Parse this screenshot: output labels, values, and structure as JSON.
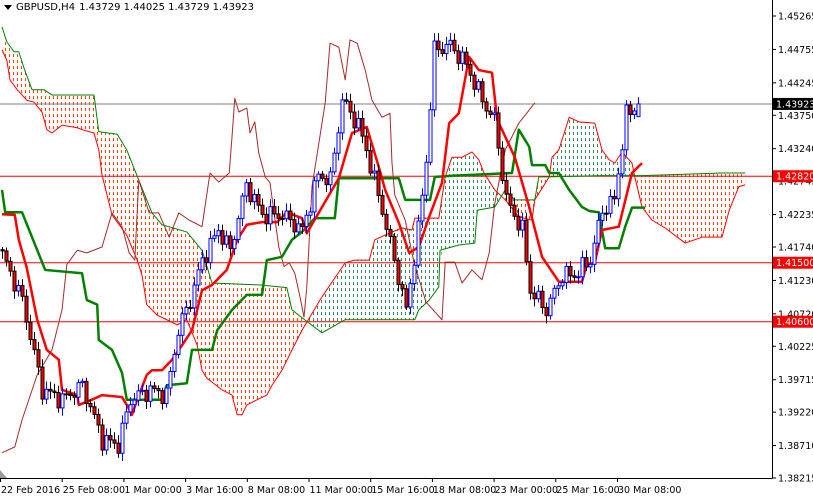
{
  "header": {
    "symbol": "GBPUSD,H4",
    "ohlc": "1.43729 1.44025 1.43729 1.43923"
  },
  "colors": {
    "bull_body": "#ffffff",
    "bull_outline": "#0000ff",
    "bear_body": "#ff0000",
    "bear_outline": "#000000",
    "tenkan": "#ff0000",
    "kijun": "#008000",
    "chikou": "#a52a2a",
    "span_a": "#ff0000",
    "span_b": "#008000",
    "cloud_bear": "#ff4500",
    "cloud_bull": "#2e8b57",
    "bid_line": "#808080",
    "level_line": "#ff0000"
  },
  "chart_data": {
    "type": "candlestick",
    "title": "GBPUSD,H4",
    "ylim": [
      1.38215,
      1.45265
    ],
    "y_ticks": [
      "1.45265",
      "1.44755",
      "1.44245",
      "1.43750",
      "1.43240",
      "1.42745",
      "1.42235",
      "1.41740",
      "1.41230",
      "1.40720",
      "1.40225",
      "1.39715",
      "1.39220",
      "1.38710",
      "1.38215"
    ],
    "x_ticks": [
      "22 Feb 2016",
      "25 Feb 08:00",
      "1 Mar 00:00",
      "3 Mar 16:00",
      "8 Mar 08:00",
      "11 Mar 00:00",
      "15 Mar 16:00",
      "18 Mar 08:00",
      "23 Mar 00:00",
      "25 Mar 16:00",
      "30 Mar 08:00"
    ],
    "bar_count": 160,
    "last_bar": {
      "open": 1.43729,
      "high": 1.44025,
      "low": 1.43729,
      "close": 1.43923
    },
    "close_keypoints": [
      [
        0,
        1.4162
      ],
      [
        5,
        1.4093
      ],
      [
        10,
        1.3956
      ],
      [
        15,
        1.3941
      ],
      [
        20,
        1.3963
      ],
      [
        25,
        1.388
      ],
      [
        29,
        1.3872
      ],
      [
        32,
        1.3941
      ],
      [
        37,
        1.3956
      ],
      [
        41,
        1.3948
      ],
      [
        44,
        1.4047
      ],
      [
        47,
        1.4093
      ],
      [
        50,
        1.4154
      ],
      [
        54,
        1.42
      ],
      [
        57,
        1.4169
      ],
      [
        61,
        1.4269
      ],
      [
        65,
        1.4223
      ],
      [
        70,
        1.4223
      ],
      [
        75,
        1.42
      ],
      [
        79,
        1.4284
      ],
      [
        82,
        1.4276
      ],
      [
        85,
        1.4398
      ],
      [
        89,
        1.436
      ],
      [
        91,
        1.4322
      ],
      [
        95,
        1.423
      ],
      [
        98,
        1.4154
      ],
      [
        101,
        1.4078
      ],
      [
        104,
        1.42
      ],
      [
        106,
        1.4307
      ],
      [
        108,
        1.4475
      ],
      [
        112,
        1.4482
      ],
      [
        116,
        1.4452
      ],
      [
        120,
        1.4398
      ],
      [
        123,
        1.4368
      ],
      [
        126,
        1.4246
      ],
      [
        130,
        1.42
      ],
      [
        132,
        1.4108
      ],
      [
        136,
        1.4078
      ],
      [
        140,
        1.4131
      ],
      [
        143,
        1.4131
      ],
      [
        147,
        1.4154
      ],
      [
        150,
        1.423
      ],
      [
        153,
        1.4246
      ],
      [
        156,
        1.4375
      ],
      [
        159,
        1.4392
      ]
    ],
    "tenkan_sen": [
      [
        0,
        1.4224
      ],
      [
        3.2,
        1.4223
      ],
      [
        4.2,
        1.4185
      ],
      [
        6.2,
        1.4142
      ],
      [
        8.8,
        1.4063
      ],
      [
        11.2,
        1.4017
      ],
      [
        14.2,
        1.4002
      ],
      [
        15,
        1.3956
      ],
      [
        18.8,
        1.3948
      ],
      [
        19.2,
        1.3933
      ],
      [
        22.5,
        1.3941
      ],
      [
        25,
        1.3948
      ],
      [
        30,
        1.3945
      ],
      [
        31.2,
        1.3933
      ],
      [
        32.5,
        1.3918
      ],
      [
        33.8,
        1.3941
      ],
      [
        36.2,
        1.3979
      ],
      [
        37.5,
        1.3986
      ],
      [
        40,
        1.3986
      ],
      [
        42.5,
        1.4002
      ],
      [
        45,
        1.4024
      ],
      [
        47.5,
        1.4047
      ],
      [
        48.8,
        1.4078
      ],
      [
        50,
        1.4108
      ],
      [
        52.5,
        1.4116
      ],
      [
        56.2,
        1.4139
      ],
      [
        58.8,
        1.4185
      ],
      [
        61.2,
        1.4208
      ],
      [
        65,
        1.4212
      ],
      [
        68.8,
        1.4212
      ],
      [
        71.2,
        1.4227
      ],
      [
        75,
        1.4218
      ],
      [
        76.2,
        1.4195
      ],
      [
        84.2,
        1.4279
      ],
      [
        87.5,
        1.4348
      ],
      [
        91.2,
        1.4357
      ],
      [
        94.2,
        1.4296
      ],
      [
        95.8,
        1.4261
      ],
      [
        99.2,
        1.4211
      ],
      [
        101.8,
        1.4165
      ],
      [
        104.2,
        1.4174
      ],
      [
        106.8,
        1.422
      ],
      [
        110,
        1.4272
      ],
      [
        111.8,
        1.4363
      ],
      [
        114.2,
        1.4378
      ],
      [
        116.8,
        1.4464
      ],
      [
        119.2,
        1.4444
      ],
      [
        122.5,
        1.444
      ],
      [
        123.8,
        1.4368
      ],
      [
        125,
        1.4353
      ],
      [
        128.2,
        1.4311
      ],
      [
        131.8,
        1.4235
      ],
      [
        135,
        1.4159
      ],
      [
        139.2,
        1.4121
      ],
      [
        145,
        1.4121
      ],
      [
        146.2,
        1.4147
      ],
      [
        148.2,
        1.415
      ],
      [
        150,
        1.42
      ],
      [
        154.2,
        1.4205
      ],
      [
        157.5,
        1.4287
      ],
      [
        160,
        1.4302
      ]
    ],
    "kijun_sen": [
      [
        0,
        1.4261
      ],
      [
        0.8,
        1.4227
      ],
      [
        5,
        1.4227
      ],
      [
        10.8,
        1.4139
      ],
      [
        20,
        1.4134
      ],
      [
        21.2,
        1.4093
      ],
      [
        23.8,
        1.4086
      ],
      [
        24.2,
        1.4032
      ],
      [
        27.5,
        1.4017
      ],
      [
        30,
        1.3982
      ],
      [
        31.2,
        1.3941
      ],
      [
        40,
        1.3941
      ],
      [
        41.2,
        1.3963
      ],
      [
        46.2,
        1.3966
      ],
      [
        47.5,
        1.4017
      ],
      [
        52.5,
        1.4017
      ],
      [
        53.8,
        1.4047
      ],
      [
        57.5,
        1.4078
      ],
      [
        61.2,
        1.4101
      ],
      [
        65,
        1.4101
      ],
      [
        66.2,
        1.4154
      ],
      [
        70,
        1.4159
      ],
      [
        72.5,
        1.4185
      ],
      [
        75,
        1.4197
      ],
      [
        78.2,
        1.4218
      ],
      [
        83.2,
        1.4218
      ],
      [
        84.2,
        1.4279
      ],
      [
        99.2,
        1.4279
      ],
      [
        100.8,
        1.4246
      ],
      [
        107,
        1.4246
      ],
      [
        108.2,
        1.4281
      ],
      [
        113.2,
        1.4283
      ],
      [
        127.5,
        1.4287
      ],
      [
        129.2,
        1.4353
      ],
      [
        131.8,
        1.4327
      ],
      [
        132.5,
        1.4299
      ],
      [
        135.8,
        1.4299
      ],
      [
        136.8,
        1.4287
      ],
      [
        139.2,
        1.4287
      ],
      [
        141.8,
        1.4261
      ],
      [
        145,
        1.4235
      ],
      [
        146.8,
        1.4229
      ],
      [
        149.2,
        1.4227
      ],
      [
        150.8,
        1.4172
      ],
      [
        154.2,
        1.4172
      ],
      [
        155.8,
        1.4205
      ],
      [
        157.5,
        1.4234
      ],
      [
        160.8,
        1.4234
      ]
    ],
    "chikou_span": [
      [
        0,
        1.386
      ],
      [
        3.2,
        1.3869
      ],
      [
        5,
        1.391
      ],
      [
        8.8,
        1.3979
      ],
      [
        12.5,
        1.4017
      ],
      [
        15,
        1.4078
      ],
      [
        16.2,
        1.4147
      ],
      [
        18.8,
        1.4169
      ],
      [
        21.2,
        1.4165
      ],
      [
        25,
        1.4174
      ],
      [
        27.5,
        1.4226
      ],
      [
        30,
        1.4205
      ],
      [
        31.8,
        1.4165
      ],
      [
        33.2,
        1.4154
      ],
      [
        34.2,
        1.4276
      ],
      [
        36.8,
        1.4226
      ],
      [
        39.2,
        1.4226
      ],
      [
        41.8,
        1.4189
      ],
      [
        44.2,
        1.4226
      ],
      [
        46.8,
        1.4215
      ],
      [
        50,
        1.4205
      ],
      [
        52,
        1.4287
      ],
      [
        54.2,
        1.4273
      ],
      [
        56.8,
        1.4287
      ],
      [
        57.5,
        1.4342
      ],
      [
        58.2,
        1.4401
      ],
      [
        59.2,
        1.438
      ],
      [
        61.2,
        1.4386
      ],
      [
        62,
        1.4348
      ],
      [
        63.2,
        1.4365
      ],
      [
        64.2,
        1.4317
      ],
      [
        65.8,
        1.4281
      ],
      [
        67,
        1.4272
      ],
      [
        69.2,
        1.4174
      ],
      [
        70.5,
        1.4144
      ],
      [
        71.8,
        1.415
      ],
      [
        73.2,
        1.4134
      ],
      [
        74.5,
        1.4098
      ],
      [
        75.5,
        1.4067
      ],
      [
        76.2,
        1.4113
      ],
      [
        77.5,
        1.4266
      ],
      [
        80.8,
        1.4394
      ],
      [
        82,
        1.4485
      ],
      [
        84.2,
        1.4479
      ],
      [
        85.8,
        1.4429
      ],
      [
        87,
        1.449
      ],
      [
        88.8,
        1.4485
      ],
      [
        90.8,
        1.4444
      ],
      [
        92.5,
        1.4398
      ],
      [
        95,
        1.4372
      ],
      [
        97,
        1.4378
      ],
      [
        97.5,
        1.4302
      ],
      [
        98.2,
        1.4253
      ],
      [
        100.8,
        1.4215
      ],
      [
        103,
        1.415
      ],
      [
        106,
        1.409
      ],
      [
        110,
        1.4063
      ],
      [
        110.8,
        1.4151
      ],
      [
        113.2,
        1.4151
      ],
      [
        115,
        1.4119
      ],
      [
        117.5,
        1.4139
      ],
      [
        120,
        1.4124
      ],
      [
        121.8,
        1.4165
      ],
      [
        123.2,
        1.4241
      ],
      [
        125.8,
        1.4322
      ],
      [
        129.2,
        1.4363
      ],
      [
        131.8,
        1.4383
      ],
      [
        133.2,
        1.4394
      ]
    ],
    "senkou_span_a": [
      [
        0,
        1.4475
      ],
      [
        1.2,
        1.4459
      ],
      [
        2,
        1.4429
      ],
      [
        3.8,
        1.4414
      ],
      [
        6.2,
        1.4398
      ],
      [
        8,
        1.4395
      ],
      [
        10,
        1.438
      ],
      [
        11.2,
        1.4353
      ],
      [
        12.5,
        1.4348
      ],
      [
        15,
        1.436
      ],
      [
        18.8,
        1.4356
      ],
      [
        20,
        1.4353
      ],
      [
        23,
        1.4348
      ],
      [
        24.2,
        1.4322
      ],
      [
        25,
        1.4284
      ],
      [
        27.5,
        1.4223
      ],
      [
        31.2,
        1.4192
      ],
      [
        33.8,
        1.4154
      ],
      [
        35,
        1.4131
      ],
      [
        36.2,
        1.4086
      ],
      [
        38.8,
        1.407
      ],
      [
        41.2,
        1.4063
      ],
      [
        43.8,
        1.4055
      ],
      [
        46.2,
        1.4063
      ],
      [
        48.8,
        1.4024
      ],
      [
        50,
        1.3986
      ],
      [
        51.2,
        1.3974
      ],
      [
        55,
        1.3956
      ],
      [
        57.5,
        1.3948
      ],
      [
        58.8,
        1.3918
      ],
      [
        60,
        1.3918
      ],
      [
        61.2,
        1.3933
      ],
      [
        63.8,
        1.3941
      ],
      [
        66.2,
        1.3948
      ],
      [
        67.5,
        1.3963
      ],
      [
        70,
        1.3986
      ],
      [
        72.5,
        1.4017
      ],
      [
        75,
        1.4047
      ],
      [
        80,
        1.4098
      ],
      [
        85.8,
        1.415
      ],
      [
        88.2,
        1.4154
      ],
      [
        91.8,
        1.4154
      ],
      [
        93.2,
        1.4185
      ],
      [
        96.8,
        1.4195
      ],
      [
        100,
        1.4203
      ],
      [
        102.5,
        1.42
      ],
      [
        103.2,
        1.4218
      ],
      [
        109.2,
        1.4218
      ],
      [
        110.8,
        1.4281
      ],
      [
        112.5,
        1.4311
      ],
      [
        115,
        1.4311
      ],
      [
        117.5,
        1.4319
      ],
      [
        119.2,
        1.4307
      ],
      [
        120.5,
        1.4287
      ],
      [
        123.2,
        1.4261
      ],
      [
        125.8,
        1.4246
      ],
      [
        129.2,
        1.422
      ],
      [
        132.5,
        1.4215
      ],
      [
        133.2,
        1.4246
      ],
      [
        136.8,
        1.4281
      ],
      [
        137.5,
        1.4311
      ],
      [
        139.2,
        1.4322
      ],
      [
        141.8,
        1.4372
      ],
      [
        144.2,
        1.4365
      ],
      [
        148.2,
        1.4363
      ],
      [
        150,
        1.4322
      ],
      [
        151.8,
        1.4307
      ],
      [
        153.2,
        1.4302
      ],
      [
        155,
        1.4319
      ],
      [
        157.5,
        1.4302
      ],
      [
        158.2,
        1.4281
      ],
      [
        160,
        1.4235
      ],
      [
        162.5,
        1.4215
      ],
      [
        165.8,
        1.4203
      ],
      [
        170.8,
        1.418
      ],
      [
        175,
        1.4189
      ],
      [
        180,
        1.4189
      ],
      [
        181.8,
        1.423
      ],
      [
        184.2,
        1.4266
      ],
      [
        185.8,
        1.4269
      ]
    ],
    "senkou_span_b": [
      [
        0,
        1.451
      ],
      [
        1.2,
        1.4487
      ],
      [
        3,
        1.4472
      ],
      [
        4.2,
        1.4472
      ],
      [
        5.5,
        1.4447
      ],
      [
        7.5,
        1.4414
      ],
      [
        10.5,
        1.4414
      ],
      [
        12.5,
        1.4406
      ],
      [
        23,
        1.4406
      ],
      [
        24.2,
        1.435
      ],
      [
        28.8,
        1.4346
      ],
      [
        31.2,
        1.4322
      ],
      [
        34.2,
        1.4276
      ],
      [
        37.5,
        1.4226
      ],
      [
        40,
        1.4208
      ],
      [
        46.2,
        1.4197
      ],
      [
        50,
        1.4169
      ],
      [
        52.5,
        1.4119
      ],
      [
        65,
        1.4116
      ],
      [
        66.2,
        1.4115
      ],
      [
        71.2,
        1.4112
      ],
      [
        72.5,
        1.4078
      ],
      [
        75,
        1.4066
      ],
      [
        80,
        1.4043
      ],
      [
        85.8,
        1.4063
      ],
      [
        103.2,
        1.4063
      ],
      [
        104.2,
        1.4078
      ],
      [
        106.8,
        1.4093
      ],
      [
        109.2,
        1.4113
      ],
      [
        109.5,
        1.4169
      ],
      [
        114.2,
        1.4177
      ],
      [
        118.2,
        1.418
      ],
      [
        118.8,
        1.423
      ],
      [
        123.2,
        1.4235
      ],
      [
        125.8,
        1.4261
      ],
      [
        128.2,
        1.4246
      ],
      [
        133.2,
        1.4246
      ],
      [
        134.2,
        1.4281
      ],
      [
        136.8,
        1.4281
      ],
      [
        150,
        1.4283
      ],
      [
        160,
        1.4283
      ],
      [
        180,
        1.4287
      ],
      [
        185.8,
        1.4287
      ]
    ],
    "horizontal_levels": [
      {
        "price": 1.43923,
        "label": "1.43923",
        "kind": "bid"
      },
      {
        "price": 1.4282,
        "label": "1.42820",
        "kind": "level"
      },
      {
        "price": 1.415,
        "label": "1.41500",
        "kind": "level"
      },
      {
        "price": 1.406,
        "label": "1.40600",
        "kind": "level"
      }
    ],
    "grid": false
  }
}
